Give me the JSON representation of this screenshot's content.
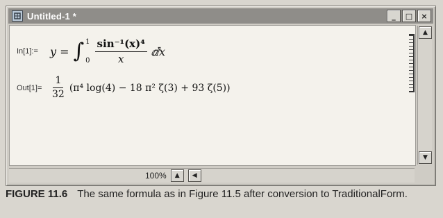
{
  "window": {
    "title": "Untitled-1 *"
  },
  "input_cell": {
    "label": "In[1]:=",
    "lhs": "y =",
    "int_upper": "1",
    "int_lower": "0",
    "numerator": "sin⁻¹(x)⁴",
    "denominator": "x",
    "differential": "ⅆx"
  },
  "output_cell": {
    "label": "Out[1]=",
    "coef_num": "1",
    "coef_den": "32",
    "expression": "(π⁴ log(4) − 18 π² ζ(3) + 93 ζ(5))"
  },
  "status": {
    "zoom": "100%"
  },
  "caption": {
    "figure": "FIGURE 11.6",
    "text": "The same formula as in Figure 11.5 after conversion to TraditionalForm."
  }
}
